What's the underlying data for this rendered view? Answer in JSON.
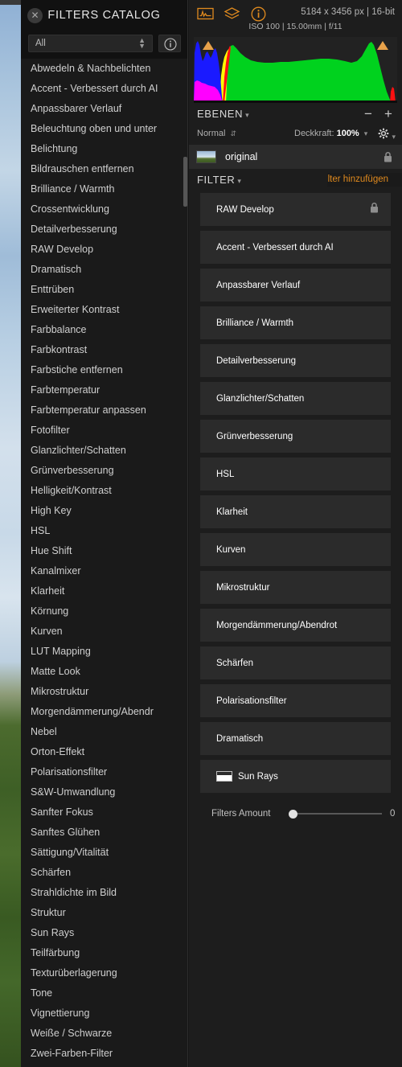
{
  "catalog": {
    "title": "FILTERS CATALOG",
    "close_icon": "close-icon",
    "category_value": "All",
    "info_icon": "info-icon",
    "items": [
      "Abwedeln & Nachbelichten",
      "Accent - Verbessert durch AI",
      "Anpassbarer Verlauf",
      "Beleuchtung oben und unter",
      "Belichtung",
      "Bildrauschen entfernen",
      "Brilliance / Warmth",
      "Crossentwicklung",
      "Detailverbesserung",
      "RAW Develop",
      "Dramatisch",
      "Enttrüben",
      "Erweiterter Kontrast",
      "Farbbalance",
      "Farbkontrast",
      "Farbstiche entfernen",
      "Farbtemperatur",
      "Farbtemperatur anpassen",
      "Fotofilter",
      "Glanzlichter/Schatten",
      "Grünverbesserung",
      "Helligkeit/Kontrast",
      "High Key",
      "HSL",
      "Hue Shift",
      "Kanalmixer",
      "Klarheit",
      "Körnung",
      "Kurven",
      "LUT Mapping",
      "Matte Look",
      "Mikrostruktur",
      "Morgendämmerung/Abendr",
      "Nebel",
      "Orton-Effekt",
      "Polarisationsfilter",
      "S&W-Umwandlung",
      "Sanfter Fokus",
      "Sanftes Glühen",
      "Sättigung/Vitalität",
      "Schärfen",
      "Strahldichte im Bild",
      "Struktur",
      "Sun Rays",
      "Teilfärbung",
      "Texturüberlagerung",
      "Tone",
      "Vignettierung",
      "Weiße / Schwarze",
      "Zwei-Farben-Filter"
    ]
  },
  "right_panel": {
    "toolbar_icons": [
      "histogram-icon",
      "layers-icon",
      "info-icon"
    ],
    "dimensions": "5184 x 3456 px | 16-bit",
    "exif": "ISO 100 | 15.00mm | f/11",
    "histogram": {
      "clip_left_icon": "clip-warning-left-icon",
      "clip_right_icon": "clip-warning-right-icon"
    },
    "layers": {
      "title": "EBENEN",
      "collapse_icon": "chevron-down-icon",
      "minus_label": "−",
      "plus_label": "+",
      "blend_mode": "Normal",
      "blend_chev_icon": "updown-chevron-icon",
      "opacity_label": "Deckkraft:",
      "opacity_value": "100%",
      "gear_icon": "gear-icon",
      "rows": [
        {
          "name": "original",
          "thumb": "layer-thumbnail",
          "lock_icon": "lock-icon"
        }
      ]
    },
    "filter_section": {
      "title": "FILTER",
      "collapse_icon": "chevron-down-icon",
      "add_label": "Filter hinzufügen",
      "items": [
        {
          "name": "RAW Develop",
          "locked": true,
          "thumb": false
        },
        {
          "name": "Accent - Verbessert durch AI",
          "locked": false,
          "thumb": false
        },
        {
          "name": "Anpassbarer Verlauf",
          "locked": false,
          "thumb": false
        },
        {
          "name": "Brilliance / Warmth",
          "locked": false,
          "thumb": false
        },
        {
          "name": "Detailverbesserung",
          "locked": false,
          "thumb": false
        },
        {
          "name": "Glanzlichter/Schatten",
          "locked": false,
          "thumb": false
        },
        {
          "name": "Grünverbesserung",
          "locked": false,
          "thumb": false
        },
        {
          "name": "HSL",
          "locked": false,
          "thumb": false
        },
        {
          "name": "Klarheit",
          "locked": false,
          "thumb": false
        },
        {
          "name": "Kurven",
          "locked": false,
          "thumb": false
        },
        {
          "name": "Mikrostruktur",
          "locked": false,
          "thumb": false
        },
        {
          "name": "Morgendämmerung/Abendrot",
          "locked": false,
          "thumb": false
        },
        {
          "name": "Schärfen",
          "locked": false,
          "thumb": false
        },
        {
          "name": "Polarisationsfilter",
          "locked": false,
          "thumb": false
        },
        {
          "name": "Dramatisch",
          "locked": false,
          "thumb": false
        },
        {
          "name": "Sun Rays",
          "locked": false,
          "thumb": true
        }
      ],
      "amount_label": "Filters Amount",
      "amount_value": "0"
    }
  },
  "colors": {
    "accent": "#e08a1e",
    "panel_bg": "#1d1d1d",
    "catalog_bg": "#1a1a1a",
    "row_bg": "#2b2b2b",
    "text": "#ffffff"
  }
}
